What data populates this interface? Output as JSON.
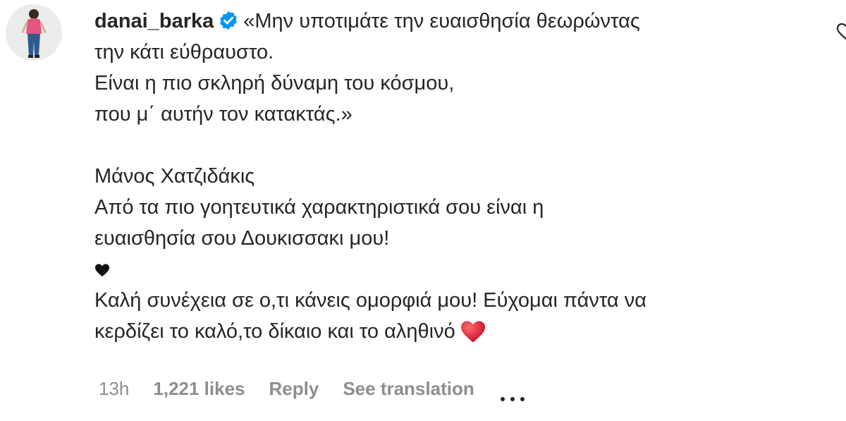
{
  "comment": {
    "username": "danai_barka",
    "verified": true,
    "verified_icon": "verified-badge-icon",
    "text_lines": [
      "«Μην υποτιμάτε την ευαισθησία θεωρώντας",
      "την κάτι εύθραυστο.",
      "Είναι η πιο σκληρή δύναμη του κόσμου,",
      "που μ΄ αυτήν τον κατακτάς.»",
      "Μάνος Χατζιδάκις",
      "Από τα πιο γοητευτικά χαρακτηριστικά σου είναι η",
      "ευαισθησία σου Δουκισσακι μου!",
      "Καλή συνέχεια σε ο,τι κάνεις ομορφιά μου! Εύχομαι πάντα να",
      "κερδίζει το καλό,το δίκαιο και το αληθινό"
    ],
    "emoji_black_heart": "black-heart-icon",
    "emoji_red_heart": "red-heart-icon",
    "meta": {
      "time": "13h",
      "likes": "1,221 likes",
      "reply": "Reply",
      "see_translation": "See translation",
      "more_icon": "more-options-icon"
    }
  },
  "colors": {
    "text": "#262626",
    "secondary": "#8e8e8e",
    "verified_blue": "#0095f6",
    "heart_red": "#e0212e"
  }
}
